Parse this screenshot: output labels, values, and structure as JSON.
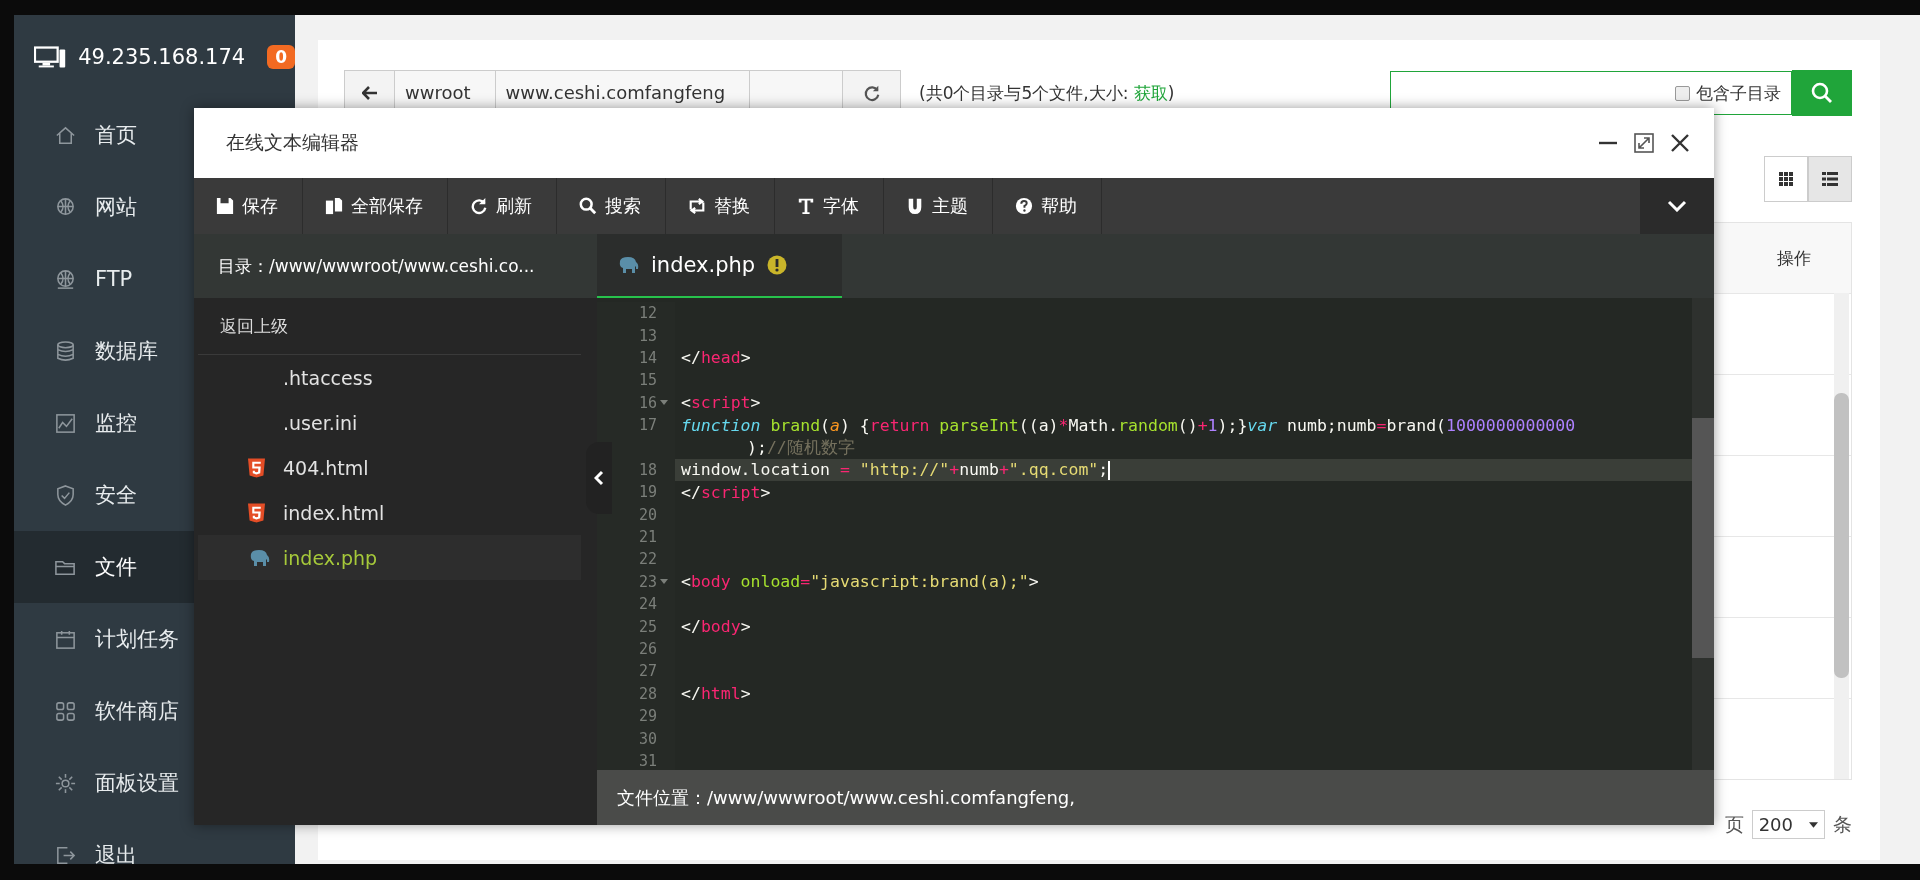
{
  "sidebar": {
    "host": "49.235.168.174",
    "badge": "0",
    "items": [
      {
        "label": "首页",
        "selected": false
      },
      {
        "label": "网站",
        "selected": false
      },
      {
        "label": "FTP",
        "selected": false
      },
      {
        "label": "数据库",
        "selected": false
      },
      {
        "label": "监控",
        "selected": false
      },
      {
        "label": "安全",
        "selected": false
      },
      {
        "label": "文件",
        "selected": true
      },
      {
        "label": "计划任务",
        "selected": false
      },
      {
        "label": "软件商店",
        "selected": false
      },
      {
        "label": "面板设置",
        "selected": false
      },
      {
        "label": "退出",
        "selected": false
      }
    ]
  },
  "path_bar": {
    "crumbs": [
      "wwroot",
      "www.ceshi.comfangfeng"
    ],
    "summary_prefix": "(共0个目录与5个文件,大小: ",
    "summary_link": "获取",
    "summary_suffix": ")",
    "include_subdirs": {
      "label": "包含子目录",
      "checked": false
    }
  },
  "view_toggle": [
    {
      "kind": "grid",
      "selected": false
    },
    {
      "kind": "list",
      "selected": true
    }
  ],
  "table": {
    "columns": [
      "操作"
    ]
  },
  "pagination": {
    "prefix": "页",
    "page_size": "200",
    "suffix": "条"
  },
  "editor": {
    "title": "在线文本编辑器",
    "toolbar": [
      "保存",
      "全部保存",
      "刷新",
      "搜索",
      "替换",
      "字体",
      "主题",
      "帮助"
    ],
    "directory": "目录：/www/wwwroot/www.ceshi.co...",
    "back_link": "返回上级",
    "files": [
      {
        "name": ".htaccess",
        "kind": "plain",
        "selected": false
      },
      {
        "name": ".user.ini",
        "kind": "plain",
        "selected": false
      },
      {
        "name": "404.html",
        "kind": "html",
        "selected": false
      },
      {
        "name": "index.html",
        "kind": "html",
        "selected": false
      },
      {
        "name": "index.php",
        "kind": "php",
        "selected": true
      }
    ],
    "tab": {
      "label": "index.php",
      "warning": true
    },
    "lines": [
      {
        "num": "12",
        "fold": false,
        "active": false
      },
      {
        "num": "13",
        "fold": false,
        "active": false
      },
      {
        "num": "14",
        "fold": false,
        "active": false,
        "tokens": [
          {
            "t": "</",
            "kind": "plain"
          },
          {
            "t": "head",
            "kind": "tag"
          },
          {
            "t": ">",
            "kind": "plain"
          }
        ]
      },
      {
        "num": "15",
        "fold": false,
        "active": false
      },
      {
        "num": "16",
        "fold": true,
        "active": false,
        "tokens": [
          {
            "t": "<",
            "kind": "plain"
          },
          {
            "t": "script",
            "kind": "tag"
          },
          {
            "t": ">",
            "kind": "plain"
          }
        ]
      },
      {
        "num": "17",
        "fold": false,
        "active": false,
        "tokens": [
          {
            "t": "function",
            "kind": "keyword"
          },
          {
            "t": " brand",
            "kind": "function"
          },
          {
            "t": "(",
            "kind": "plain"
          },
          {
            "t": "a",
            "kind": "param"
          },
          {
            "t": ") {",
            "kind": "plain"
          },
          {
            "t": "return",
            "kind": "operator"
          },
          {
            "t": " parseInt",
            "kind": "function"
          },
          {
            "t": "((a)",
            "kind": "plain"
          },
          {
            "t": "*",
            "kind": "operator"
          },
          {
            "t": "Math.",
            "kind": "plain"
          },
          {
            "t": "random",
            "kind": "function"
          },
          {
            "t": "()",
            "kind": "plain"
          },
          {
            "t": "+",
            "kind": "operator"
          },
          {
            "t": "1",
            "kind": "number"
          },
          {
            "t": ");}",
            "kind": "plain"
          },
          {
            "t": "var",
            "kind": "keyword"
          },
          {
            "t": " numb;numb",
            "kind": "plain"
          },
          {
            "t": "=",
            "kind": "operator"
          },
          {
            "t": "brand(",
            "kind": "plain"
          },
          {
            "t": "1000000000000",
            "kind": "number"
          }
        ],
        "wrap": [
          {
            "t": ");",
            "kind": "plain"
          },
          {
            "t": "//随机数字",
            "kind": "comment"
          }
        ]
      },
      {
        "num": "18",
        "fold": false,
        "active": true,
        "tokens": [
          {
            "t": "window.location ",
            "kind": "plain"
          },
          {
            "t": "=",
            "kind": "operator"
          },
          {
            "t": " \"http://\"",
            "kind": "string"
          },
          {
            "t": "+",
            "kind": "operator"
          },
          {
            "t": "numb",
            "kind": "plain"
          },
          {
            "t": "+",
            "kind": "operator"
          },
          {
            "t": "\".qq.com\"",
            "kind": "string"
          },
          {
            "t": ";",
            "kind": "plain"
          }
        ]
      },
      {
        "num": "19",
        "fold": false,
        "active": false,
        "tokens": [
          {
            "t": "</",
            "kind": "plain"
          },
          {
            "t": "script",
            "kind": "tag"
          },
          {
            "t": ">",
            "kind": "plain"
          }
        ]
      },
      {
        "num": "20",
        "fold": false,
        "active": false
      },
      {
        "num": "21",
        "fold": false,
        "active": false
      },
      {
        "num": "22",
        "fold": false,
        "active": false
      },
      {
        "num": "23",
        "fold": true,
        "active": false,
        "tokens": [
          {
            "t": "<",
            "kind": "plain"
          },
          {
            "t": "body",
            "kind": "tag"
          },
          {
            "t": " onload",
            "kind": "attr"
          },
          {
            "t": "=",
            "kind": "operator"
          },
          {
            "t": "\"javascript:brand(a);\"",
            "kind": "string"
          },
          {
            "t": ">",
            "kind": "plain"
          }
        ]
      },
      {
        "num": "24",
        "fold": false,
        "active": false
      },
      {
        "num": "25",
        "fold": false,
        "active": false,
        "tokens": [
          {
            "t": "</",
            "kind": "plain"
          },
          {
            "t": "body",
            "kind": "tag"
          },
          {
            "t": ">",
            "kind": "plain"
          }
        ]
      },
      {
        "num": "26",
        "fold": false,
        "active": false
      },
      {
        "num": "27",
        "fold": false,
        "active": false
      },
      {
        "num": "28",
        "fold": false,
        "active": false,
        "tokens": [
          {
            "t": "</",
            "kind": "plain"
          },
          {
            "t": "html",
            "kind": "tag"
          },
          {
            "t": ">",
            "kind": "plain"
          }
        ]
      },
      {
        "num": "29",
        "fold": false,
        "active": false
      },
      {
        "num": "30",
        "fold": false,
        "active": false
      },
      {
        "num": "31",
        "fold": false,
        "active": false
      }
    ],
    "status": "文件位置：/www/wwwroot/www.ceshi.comfangfeng,"
  }
}
